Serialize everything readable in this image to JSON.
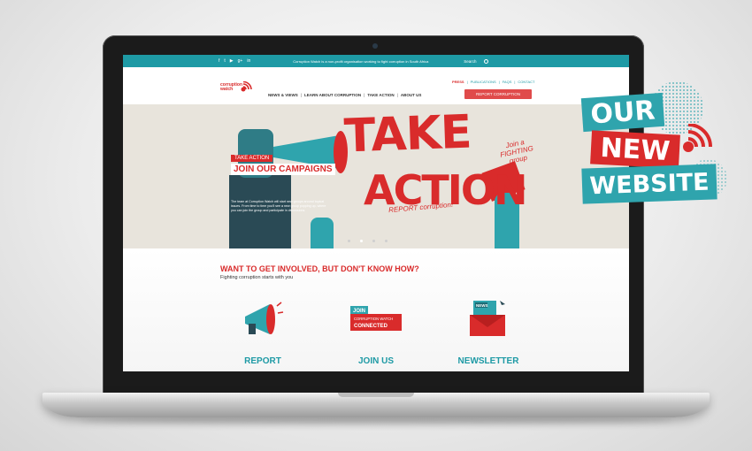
{
  "topbar": {
    "social_icons": [
      "facebook-icon",
      "twitter-icon",
      "youtube-icon",
      "googleplus-icon",
      "linkedin-icon"
    ],
    "social_glyphs": [
      "f",
      "t",
      "▶",
      "g+",
      "in"
    ],
    "tagline": "Corruption Watch is a non-profit organisation working to fight corruption in South Africa",
    "search_label": "Search"
  },
  "header": {
    "logo_line1": "corruption",
    "logo_line2": "watch",
    "top_links": {
      "press": "PRESS",
      "publications": "PUBLICATIONS",
      "faqs": "FAQS",
      "contact": "CONTACT"
    },
    "nav": [
      "NEWS & VIEWS",
      "LEARN ABOUT CORRUPTION",
      "TAKE ACTION",
      "ABOUT US"
    ],
    "report_button": "REPORT CORRUPTION"
  },
  "hero": {
    "art_take": "TAKE",
    "art_action": "ACTION",
    "art_join_group": "Join a FIGHTING group",
    "art_report": "REPORT corruption!",
    "tag": "TAKE ACTION",
    "title": "JOIN OUR CAMPAIGNS",
    "description": "The team at Corruption Watch will start new groups around topical issues. From time to time you'll see a new group popping up, where you can join the group and participate in discussions.",
    "slide_count": 4,
    "active_slide": 2
  },
  "lower": {
    "title": "WANT TO GET INVOLVED, BUT DON'T KNOW HOW?",
    "subtitle": "Fighting corruption starts with you",
    "join_icon_text_1": "JOIN",
    "join_icon_text_2": "CORRUPTION WATCH",
    "join_icon_text_3": "CONNECTED",
    "news_icon_text": "NEWS",
    "ctas": [
      "REPORT",
      "JOIN US",
      "NEWSLETTER"
    ]
  },
  "badge": {
    "line1": "OUR",
    "line2": "NEW",
    "line3": "WEBSITE"
  },
  "colors": {
    "teal": "#1e9aa5",
    "red": "#d92b2b",
    "dark": "#1b1b1b"
  }
}
